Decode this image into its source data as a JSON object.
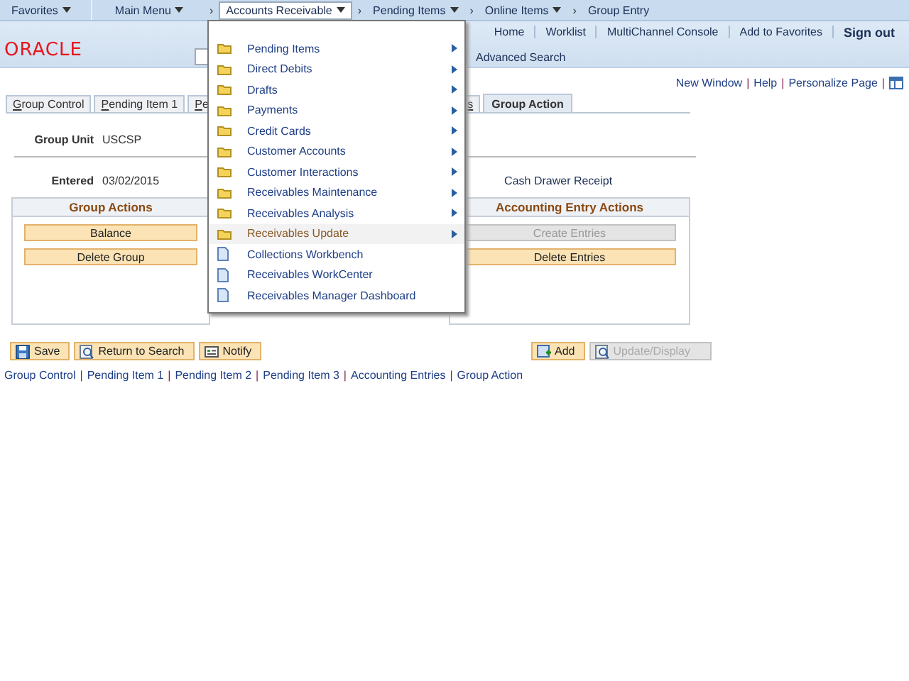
{
  "nav_bar": {
    "separator": "›",
    "items": [
      {
        "label": "Favorites",
        "dropdown": true,
        "selected": false
      },
      {
        "label": "Main Menu",
        "dropdown": true,
        "selected": false
      },
      {
        "label": "Accounts Receivable",
        "dropdown": true,
        "selected": true
      },
      {
        "label": "Pending Items",
        "dropdown": true,
        "selected": false
      },
      {
        "label": "Online Items",
        "dropdown": true,
        "selected": false
      },
      {
        "label": "Group Entry",
        "dropdown": false,
        "selected": false
      }
    ]
  },
  "header": {
    "logo": "ORACLE",
    "links": [
      {
        "label": "Home",
        "kind": "link"
      },
      {
        "label": "Worklist",
        "kind": "link"
      },
      {
        "label": "MultiChannel Console",
        "kind": "link"
      },
      {
        "label": "Add to Favorites",
        "kind": "link"
      },
      {
        "label": "Sign out",
        "kind": "strong"
      }
    ],
    "advanced_search": "Advanced Search"
  },
  "page_links": {
    "separator": "|",
    "items": [
      "New Window",
      "Help",
      "Personalize Page"
    ]
  },
  "tabs": [
    {
      "label": "Group Control",
      "selected": false
    },
    {
      "label": "Pending Item 1",
      "selected": false
    },
    {
      "label": "Pe",
      "selected": false
    },
    {
      "label": "s",
      "selected": false
    },
    {
      "label": "Group Action",
      "selected": true
    }
  ],
  "fields": [
    {
      "label": "Group Unit",
      "value": "USCSP"
    },
    {
      "label": "Entered",
      "value": "03/02/2015"
    }
  ],
  "cash_drawer_receipt": "Cash Drawer Receipt",
  "group_actions": {
    "title": "Group Actions",
    "buttons": [
      {
        "label": "Balance",
        "disabled": false
      },
      {
        "label": "Delete Group",
        "disabled": false
      }
    ]
  },
  "accounting_entry_actions": {
    "title": "Accounting Entry Actions",
    "buttons": [
      {
        "label": "Create Entries",
        "disabled": true
      },
      {
        "label": "Delete Entries",
        "disabled": false
      }
    ]
  },
  "toolbar": {
    "left": [
      {
        "label": "Save",
        "disabled": false
      },
      {
        "label": "Return to Search",
        "disabled": false
      },
      {
        "label": "Notify",
        "disabled": false
      }
    ],
    "right": [
      {
        "label": "Add",
        "disabled": false
      },
      {
        "label": "Update/Display",
        "disabled": true
      }
    ]
  },
  "footer_links": {
    "separator": "|",
    "items": [
      "Group Control",
      "Pending Item 1",
      "Pending Item 2",
      "Pending Item 3",
      "Accounting Entries",
      "Group Action"
    ]
  },
  "menu": {
    "items": [
      {
        "label": "Pending Items",
        "kind": "folder",
        "submenu": true,
        "selected": false
      },
      {
        "label": "Direct Debits",
        "kind": "folder",
        "submenu": true,
        "selected": false
      },
      {
        "label": "Drafts",
        "kind": "folder",
        "submenu": true,
        "selected": false
      },
      {
        "label": "Payments",
        "kind": "folder",
        "submenu": true,
        "selected": false
      },
      {
        "label": "Credit Cards",
        "kind": "folder",
        "submenu": true,
        "selected": false
      },
      {
        "label": "Customer Accounts",
        "kind": "folder",
        "submenu": true,
        "selected": false
      },
      {
        "label": "Customer Interactions",
        "kind": "folder",
        "submenu": true,
        "selected": false
      },
      {
        "label": "Receivables Maintenance",
        "kind": "folder",
        "submenu": true,
        "selected": false
      },
      {
        "label": "Receivables Analysis",
        "kind": "folder",
        "submenu": true,
        "selected": false
      },
      {
        "label": "Receivables Update",
        "kind": "folder",
        "submenu": true,
        "selected": true
      },
      {
        "label": "Collections Workbench",
        "kind": "page",
        "submenu": false,
        "selected": false
      },
      {
        "label": "Receivables WorkCenter",
        "kind": "page",
        "submenu": false,
        "selected": false
      },
      {
        "label": "Receivables Manager Dashboard",
        "kind": "page",
        "submenu": false,
        "selected": false
      }
    ]
  }
}
